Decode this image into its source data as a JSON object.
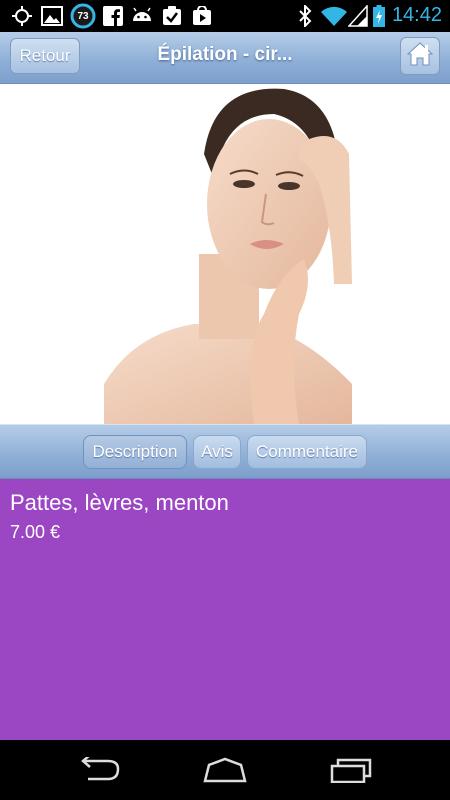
{
  "status_bar": {
    "time": "14:42",
    "notification_count": "73",
    "icons": [
      "gps-icon",
      "image-icon",
      "badge-73-icon",
      "facebook-icon",
      "android-icon",
      "checkbox-icon",
      "play-store-icon",
      "bluetooth-icon",
      "wifi-icon",
      "signal-icon",
      "battery-icon"
    ]
  },
  "header": {
    "back_label": "Retour",
    "title": "Épilation - cir...",
    "home_icon": "home-icon"
  },
  "tabs": [
    {
      "label": "Description",
      "active": true
    },
    {
      "label": "Avis",
      "active": false
    },
    {
      "label": "Commentaire",
      "active": false
    }
  ],
  "product": {
    "name": "Pattes, lèvres, menton",
    "price": "7.00 €"
  },
  "colors": {
    "content_bg": "#9b47c3",
    "header_bar": "#8fb0d7",
    "status_accent": "#33b5e5"
  },
  "nav": {
    "icons": [
      "back-icon",
      "home-icon",
      "recent-apps-icon"
    ]
  }
}
